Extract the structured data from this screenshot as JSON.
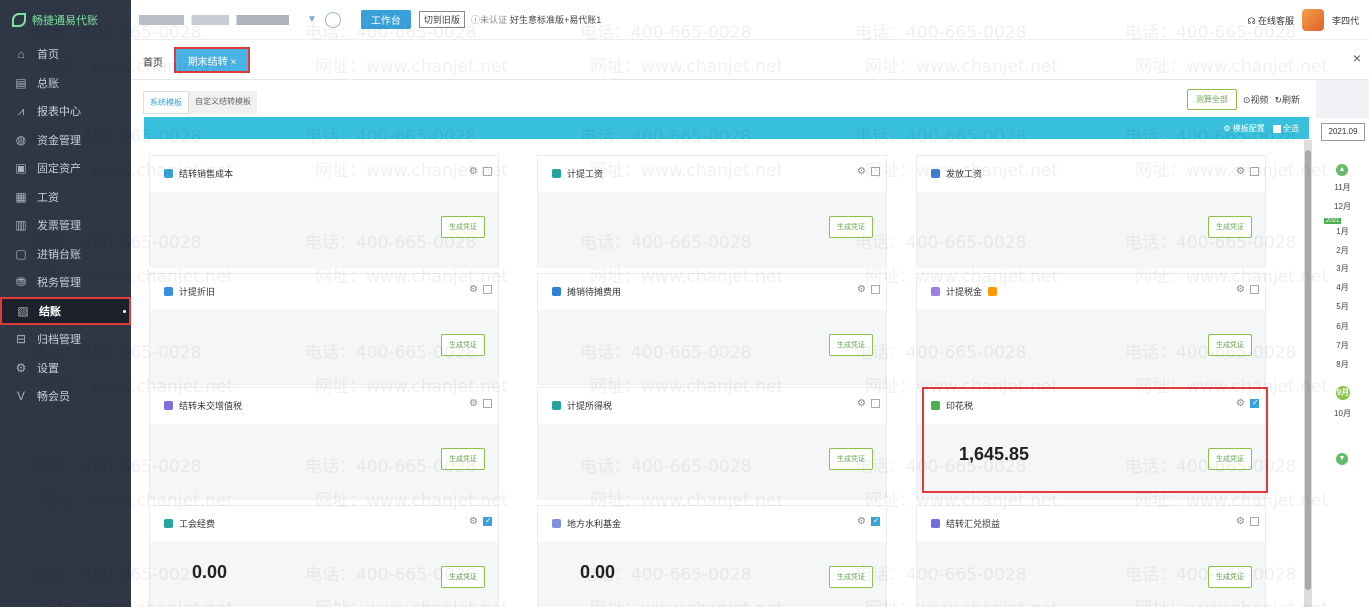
{
  "app": {
    "logo_text": "畅捷通易代账"
  },
  "sidebar": {
    "items": [
      {
        "label": "首页",
        "icon": "home-icon",
        "glyph": "⌂"
      },
      {
        "label": "总账",
        "icon": "ledger-icon",
        "glyph": "▤"
      },
      {
        "label": "报表中心",
        "icon": "report-icon",
        "glyph": "⩘"
      },
      {
        "label": "资金管理",
        "icon": "fund-icon",
        "glyph": "◍"
      },
      {
        "label": "固定资产",
        "icon": "asset-icon",
        "glyph": "▣"
      },
      {
        "label": "工资",
        "icon": "salary-icon",
        "glyph": "▦"
      },
      {
        "label": "发票管理",
        "icon": "invoice-icon",
        "glyph": "▥"
      },
      {
        "label": "进销台账",
        "icon": "inventory-icon",
        "glyph": "▢"
      },
      {
        "label": "税务管理",
        "icon": "tax-icon",
        "glyph": "⛃"
      },
      {
        "label": "结账",
        "icon": "closing-icon",
        "glyph": "▧",
        "active": true
      },
      {
        "label": "归档管理",
        "icon": "archive-icon",
        "glyph": "⊟"
      },
      {
        "label": "设置",
        "icon": "settings-icon",
        "glyph": "⚙"
      },
      {
        "label": "畅会员",
        "icon": "vip-icon",
        "glyph": "V"
      }
    ]
  },
  "topbar": {
    "workbench": "工作台",
    "switch_old": "切到旧版",
    "verify": "未认证",
    "version": "好生意标准版+易代账1",
    "online_service": "在线客服",
    "user": "李四代"
  },
  "tabs": {
    "home": "首页",
    "active": "期末结转 ×",
    "close_all": "×"
  },
  "main": {
    "subtabs": [
      "系统模板",
      "自定义结转模板"
    ],
    "calc_all": "测算全部",
    "video": "视频",
    "refresh": "刷新",
    "template_config": "模板配置",
    "select_all": "全选"
  },
  "cards": [
    {
      "title": "结转销售成本",
      "icon_color": "#3aa0d8",
      "checked": false,
      "amount": "",
      "gen": "生成凭证"
    },
    {
      "title": "计提工资",
      "icon_color": "#26a69a",
      "checked": false,
      "amount": "",
      "gen": "生成凭证"
    },
    {
      "title": "发放工资",
      "icon_color": "#3f7fd8",
      "checked": false,
      "amount": "",
      "gen": "生成凭证"
    },
    {
      "title": "计提折旧",
      "icon_color": "#3a8ee6",
      "checked": false,
      "amount": "",
      "gen": "生成凭证"
    },
    {
      "title": "摊销待摊费用",
      "icon_color": "#2f7fd8",
      "checked": false,
      "amount": "",
      "gen": "生成凭证"
    },
    {
      "title": "计提税金",
      "icon_color": "#9c7fe0",
      "checked": false,
      "amount": "",
      "gen": "生成凭证",
      "badge": true
    },
    {
      "title": "结转未交增值税",
      "icon_color": "#7e6fe0",
      "checked": false,
      "amount": "",
      "gen": "生成凭证"
    },
    {
      "title": "计提所得税",
      "icon_color": "#26a69a",
      "checked": false,
      "amount": "",
      "gen": "生成凭证"
    },
    {
      "title": "印花税",
      "icon_color": "#4caf50",
      "checked": true,
      "amount": "1,645.85",
      "gen": "生成凭证"
    },
    {
      "title": "工会经费",
      "icon_color": "#26a69a",
      "checked": true,
      "amount": "0.00",
      "gen": "生成凭证"
    },
    {
      "title": "地方水利基金",
      "icon_color": "#7e8fe0",
      "checked": true,
      "amount": "0.00",
      "gen": "生成凭证"
    },
    {
      "title": "结转汇兑损益",
      "icon_color": "#6f6fe0",
      "checked": false,
      "amount": "",
      "gen": "生成凭证"
    }
  ],
  "period": {
    "year": "2021.09",
    "year_tag": "2021",
    "months": [
      "11月",
      "12月",
      "1月",
      "2月",
      "3月",
      "4月",
      "5月",
      "6月",
      "7月",
      "8月",
      "9月",
      "10月"
    ],
    "current": "9月"
  },
  "watermarks": {
    "phone": "电话：400-665-0028",
    "site": "网址：www.chanjet.net"
  }
}
